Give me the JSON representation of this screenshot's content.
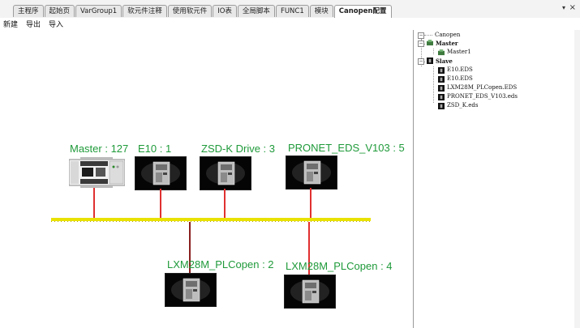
{
  "tabs": [
    {
      "label": "主程序"
    },
    {
      "label": "起始页"
    },
    {
      "label": "VarGroup1"
    },
    {
      "label": "软元件注释"
    },
    {
      "label": "使用软元件"
    },
    {
      "label": "IO表"
    },
    {
      "label": "全局脚本"
    },
    {
      "label": "FUNC1"
    },
    {
      "label": "模块"
    },
    {
      "label": "Canopen配置"
    }
  ],
  "tab_controls": {
    "dropdown": "▾",
    "close": "×"
  },
  "toolbar": {
    "new_label": "新建",
    "export_label": "导出",
    "import_label": "导入"
  },
  "network": {
    "master": {
      "label": "Master : 127"
    },
    "top_nodes": [
      {
        "label": "E10 : 1"
      },
      {
        "label": "ZSD-K Drive : 3"
      },
      {
        "label": "PRONET_EDS_V103 : 5"
      }
    ],
    "bottom_nodes": [
      {
        "label": "LXM28M_PLCopen : 2"
      },
      {
        "label": "LXM28M_PLCopen : 4"
      }
    ],
    "colors": {
      "label": "#1f9a3a",
      "bus": "#e9e200",
      "link": "#e03030"
    }
  },
  "tree": {
    "root": "Canopen",
    "master_group": "Master",
    "master_item": "Master1",
    "slave_group": "Slave",
    "slaves": [
      "E10.EDS",
      "E10.EDS",
      "LXM28M_PLCopen.EDS",
      "PRONET_EDS_V103.eds",
      "ZSD_K.eds"
    ]
  }
}
